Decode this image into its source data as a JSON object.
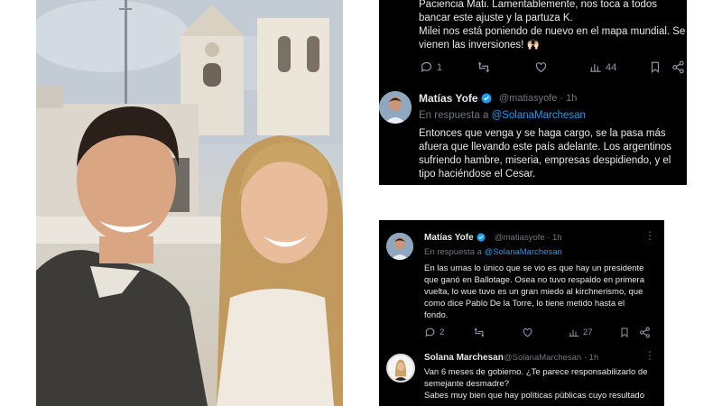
{
  "card1": {
    "top_tweet_lines": [
      "Paciencia Mati. Lamentablemente, nos toca a todos",
      "bancar este ajuste y la partuza K.",
      "Milei nos está poniendo de nuevo en el mapa mundial. Se",
      "vienen las inversiones! 🙌🏻"
    ],
    "actions": {
      "replies": "1",
      "reposts": "",
      "likes": "",
      "views": "44"
    },
    "reply_tweet": {
      "name": "Matías Yofe",
      "handle": "@matiasyofe · 1h",
      "reply_prefix": "En respuesta a ",
      "reply_mention": "@SolanaMarchesan",
      "lines": [
        "Entonces que venga y se haga cargo, se la pasa más",
        "afuera que llevando este país adelante. Los argentinos",
        "sufriendo hambre, miseria, empresas despidiendo, y el",
        "tipo haciéndose el Cesar."
      ]
    }
  },
  "card2": {
    "tweet": {
      "name": "Matías Yofe",
      "handle": "@matiasyofe · 1h",
      "reply_prefix": "En respuesta a ",
      "reply_mention": "@SolanaMarchesan",
      "lines": [
        "En las urnas lo único que se vio es que hay un presidente",
        "que ganó en Ballotage. Osea no tuvo respaldo en primera",
        "vuelta, lo wue tuvo es un gran miedo al kirchnerismo, que",
        "como dice Pablo De la Torre, lo tiene metido hasta el",
        "fondo."
      ]
    },
    "actions": {
      "replies": "2",
      "reposts": "",
      "likes": "",
      "views": "27"
    },
    "second_tweet": {
      "name": "Solana Marchesan",
      "handle": "@SolanaMarchesan · 1h",
      "lines": [
        "Van 6 meses de gobierno. ¿Te parece responsabilizarlo de",
        "semejante desmadre?",
        "Sabes muy bien que hay políticas públicas cuyo resultado"
      ]
    }
  },
  "colors": {
    "card_bg": "#000000",
    "text": "#e7e9ea",
    "muted": "#71767b",
    "link": "#1d9bf0",
    "verified": "#1d9bf0"
  },
  "icons": [
    "reply-icon",
    "repost-icon",
    "like-icon",
    "views-icon",
    "bookmark-icon",
    "share-icon",
    "verified-badge-icon",
    "more-icon"
  ]
}
